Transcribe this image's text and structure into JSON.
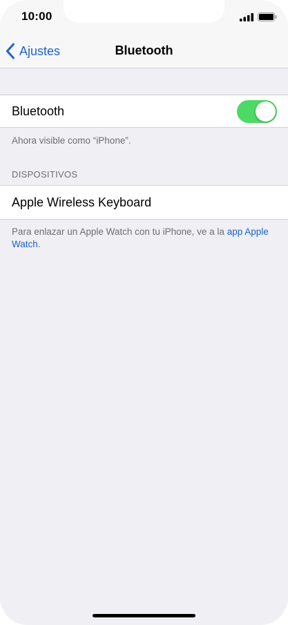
{
  "status_bar": {
    "time": "10:00"
  },
  "nav": {
    "back_label": "Ajustes",
    "title": "Bluetooth"
  },
  "bluetooth": {
    "label": "Bluetooth",
    "enabled": true,
    "visibility_note": "Ahora visible como “iPhone”."
  },
  "devices": {
    "header": "DISPOSITIVOS",
    "items": [
      {
        "name": "Apple Wireless Keyboard"
      }
    ]
  },
  "pairing_note": {
    "text": "Para enlazar un Apple Watch con tu iPhone, ve a la ",
    "link_text": "app Apple Watch",
    "suffix": "."
  },
  "colors": {
    "accent": "#1d64c9",
    "toggle_on": "#4cd964",
    "background": "#efeff4"
  },
  "icons": {
    "back": "chevron-left-icon",
    "signal": "cellular-signal-icon",
    "battery": "battery-icon"
  }
}
